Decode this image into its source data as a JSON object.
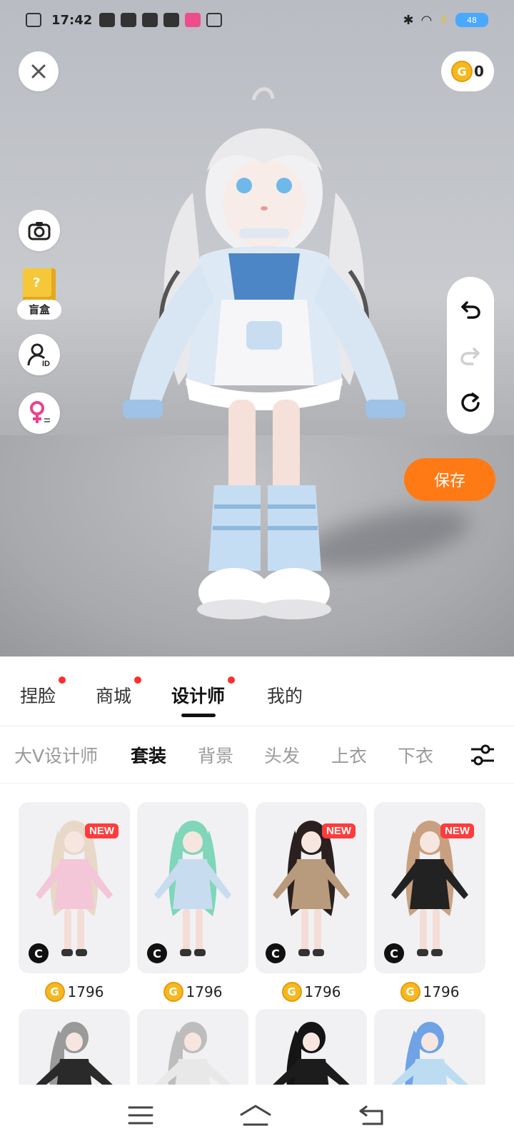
{
  "status_bar": {
    "time": "17:42",
    "battery_level": "48"
  },
  "wallet": {
    "coins": "0",
    "coin_symbol": "G"
  },
  "left_tools": {
    "blind_box_label": "盲盒"
  },
  "actions": {
    "save_label": "保存"
  },
  "main_tabs": [
    {
      "label": "捏脸",
      "dot": true
    },
    {
      "label": "商城",
      "dot": true
    },
    {
      "label": "设计师",
      "dot": true,
      "active": true
    },
    {
      "label": "我的",
      "dot": false
    }
  ],
  "sub_tabs": [
    {
      "label": "大V设计师"
    },
    {
      "label": "套装",
      "active": true
    },
    {
      "label": "背景"
    },
    {
      "label": "头发"
    },
    {
      "label": "上衣"
    },
    {
      "label": "下衣"
    }
  ],
  "items": [
    {
      "badge": "NEW",
      "creator_badge": "C",
      "price": "1796",
      "outfit_color": "#f3c6d8",
      "hair_color": "#e8d8c8"
    },
    {
      "badge": "",
      "creator_badge": "C",
      "price": "1796",
      "outfit_color": "#c8dcef",
      "hair_color": "#7fd6b8"
    },
    {
      "badge": "NEW",
      "creator_badge": "C",
      "price": "1796",
      "outfit_color": "#b89a7c",
      "hair_color": "#2a2020"
    },
    {
      "badge": "NEW",
      "creator_badge": "C",
      "price": "1796",
      "outfit_color": "#222222",
      "hair_color": "#c8a080"
    }
  ],
  "row2_items": [
    {
      "outfit_color": "#2a2a2a",
      "hair_color": "#9a9a9a"
    },
    {
      "outfit_color": "#e8e8e8",
      "hair_color": "#bdbdbd"
    },
    {
      "outfit_color": "#1c1c1c",
      "hair_color": "#151515"
    },
    {
      "outfit_color": "#bcdcf2",
      "hair_color": "#6fa3e6"
    }
  ],
  "colors": {
    "accent_orange": "#ff7a14",
    "notification_red": "#ff2d2d",
    "coin_gold": "#f6b81f"
  },
  "icons": {
    "close": "close-icon",
    "camera": "camera-icon",
    "blind_box": "blind-box-icon",
    "avatar_id": "user-id-icon",
    "gender": "female-switch-icon",
    "undo": "undo-icon",
    "redo": "redo-icon",
    "reset": "reset-icon",
    "filter": "filter-sliders-icon",
    "menu": "menu-icon",
    "home": "home-icon",
    "back": "back-icon"
  }
}
